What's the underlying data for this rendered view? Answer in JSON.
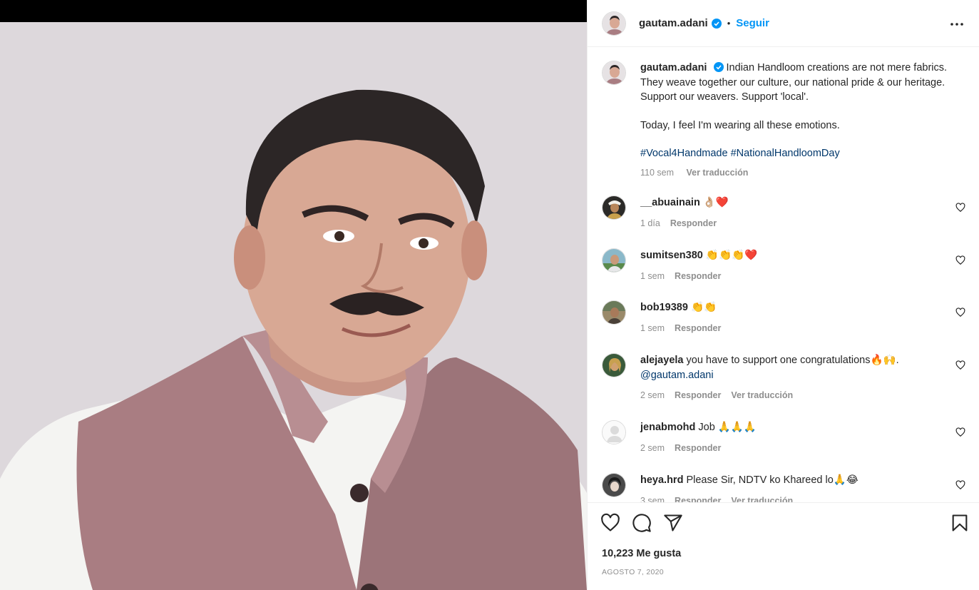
{
  "post": {
    "username": "gautam.adani",
    "follow_label": "Seguir",
    "separator": "•",
    "likes": "10,223 Me gusta",
    "date": "AGOSTO 7, 2020"
  },
  "caption": {
    "username": "gautam.adani",
    "text_1": "Indian Handloom creations are not mere fabrics. They weave together our culture, our national pride & our heritage. Support our weavers. Support 'local'.",
    "text_2": "Today, I feel I'm wearing all these emotions.",
    "hashtag_1": "#Vocal4Handmade",
    "hashtag_2": "#NationalHandloomDay",
    "time": "110 sem",
    "translate": "Ver traducción"
  },
  "comments": [
    {
      "username": "__abuainain",
      "text": "👌🏼❤️",
      "mention": "",
      "time": "1 día",
      "reply": "Responder",
      "translate": ""
    },
    {
      "username": "sumitsen380",
      "text": "👏👏👏❤️",
      "mention": "",
      "time": "1 sem",
      "reply": "Responder",
      "translate": ""
    },
    {
      "username": "bob19389",
      "text": "👏👏",
      "mention": "",
      "time": "1 sem",
      "reply": "Responder",
      "translate": ""
    },
    {
      "username": "alejayela",
      "text": "you have to support one congratulations🔥🙌.",
      "mention": "@gautam.adani",
      "time": "2 sem",
      "reply": "Responder",
      "translate": "Ver traducción"
    },
    {
      "username": "jenabmohd",
      "text": "Job 🙏🙏🙏",
      "mention": "",
      "time": "2 sem",
      "reply": "Responder",
      "translate": ""
    },
    {
      "username": "heya.hrd",
      "text": "Please Sir, NDTV ko Khareed lo🙏😂",
      "mention": "",
      "time": "3 sem",
      "reply": "Responder",
      "translate": "Ver traducción"
    }
  ],
  "icons": {
    "more": "more-options-icon",
    "like": "heart-icon",
    "comment": "comment-icon",
    "share": "share-icon",
    "save": "bookmark-icon",
    "verified": "verified-badge-icon"
  },
  "colors": {
    "link": "#0095f6",
    "hashtag": "#00376b",
    "muted": "#8e8e8e",
    "verified": "#0095f6"
  }
}
